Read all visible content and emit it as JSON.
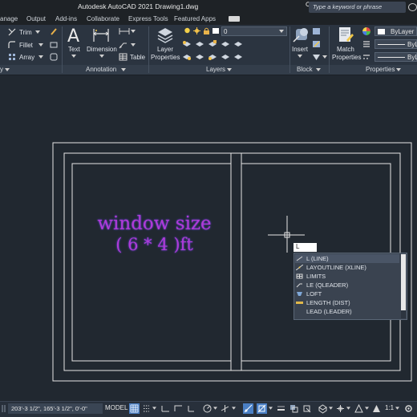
{
  "titlebar": {
    "title": "Autodesk AutoCAD 2021    Drawing1.dwg",
    "search_placeholder": "Type a keyword or phrase"
  },
  "tabs": [
    "anage",
    "Output",
    "Add-ins",
    "Collaborate",
    "Express Tools",
    "Featured Apps"
  ],
  "ribbon": {
    "modify": {
      "trim": "Trim",
      "fillet": "Fillet",
      "array": "Array"
    },
    "annotation": {
      "text": "Text",
      "dimension": "Dimension",
      "table": "Table",
      "panel_title": "Annotation"
    },
    "layers": {
      "layer_properties_1": "Layer",
      "layer_properties_2": "Properties",
      "layer_combo": "0",
      "panel_title": "Layers"
    },
    "block": {
      "insert": "Insert",
      "panel_title": "Block"
    },
    "properties": {
      "match_1": "Match",
      "match_2": "Properties",
      "bylayer_1": "ByLayer",
      "bylayer_2": "ByL",
      "bylayer_3": "ByL",
      "panel_title": "Properties"
    },
    "left_panel_title": "y"
  },
  "annotation_text": {
    "line1": "window size",
    "line2": "( 6 * 4 )ft"
  },
  "command": {
    "typed": "L",
    "suggestions": [
      {
        "label": "L (LINE)",
        "icon": "line-icon"
      },
      {
        "label": "LAYOUTLINE (XLINE)",
        "icon": "xline-icon"
      },
      {
        "label": "LIMITS",
        "icon": "limits-icon"
      },
      {
        "label": "LE (QLEADER)",
        "icon": "qleader-icon"
      },
      {
        "label": "LOFT",
        "icon": "loft-icon"
      },
      {
        "label": "LENGTH (DIST)",
        "icon": "dist-icon"
      },
      {
        "label": "LEAD (LEADER)",
        "icon": "leader-icon"
      }
    ]
  },
  "statusbar": {
    "coords": "203'-3 1/2\", 165'-3 1/2\", 0'-0\"",
    "model": "MODEL",
    "scale": "1:1"
  },
  "colors": {
    "canvas": "#212830",
    "ribbon": "#2b3440",
    "annotation": "#b23ad6",
    "accent": "#4a7fc4"
  }
}
